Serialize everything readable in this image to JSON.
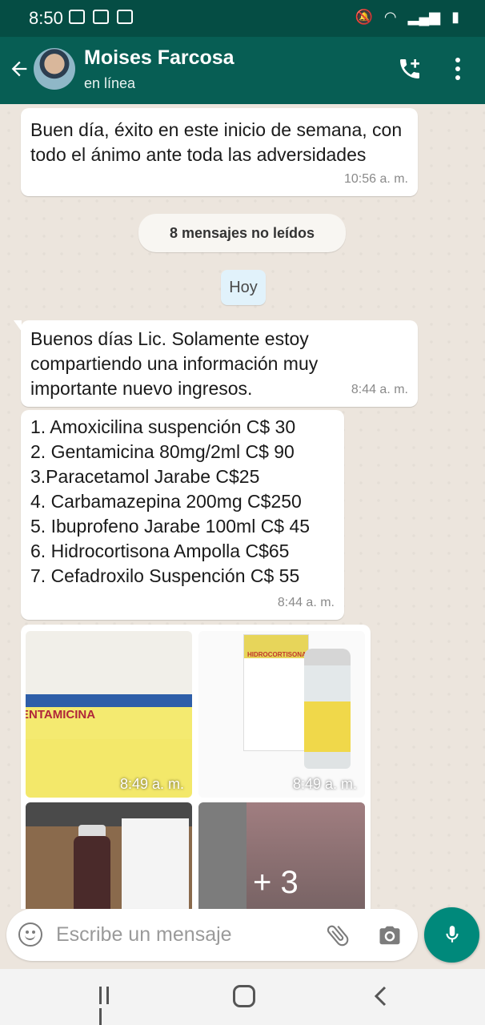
{
  "status_bar": {
    "time": "8:50",
    "left_icons": [
      "gallery-icon",
      "voicemail-icon",
      "instagram-icon"
    ],
    "right_icons": [
      "mute-icon",
      "wifi-icon",
      "signal-icon",
      "battery-icon"
    ]
  },
  "header": {
    "contact_name": "Moises Farcosa",
    "contact_status": "en línea",
    "icons": [
      "back-arrow-icon",
      "add-call-icon",
      "more-vert-icon"
    ]
  },
  "chat": {
    "messages": [
      {
        "text": "Buen día, éxito en este inicio de semana, con todo el ánimo ante toda las adversidades",
        "time": "10:56 a. m."
      },
      {
        "text": "Buenos días Lic. Solamente estoy compartiendo una información muy importante nuevo ingresos.",
        "time": "8:44 a. m."
      }
    ],
    "unread_banner": "8 mensajes no leídos",
    "date_chip": "Hoy",
    "price_list": {
      "items": [
        "1. Amoxicilina suspención C$ 30",
        "2. Gentamicina 80mg/2ml C$ 90",
        "3.Paracetamol Jarabe C$25",
        "4. Carbamazepina 200mg C$250",
        "5. Ibuprofeno Jarabe 100ml C$ 45",
        "6. Hidrocortisona Ampolla C$65",
        "7. Cefadroxilo Suspención C$ 55"
      ],
      "time": "8:44 a. m."
    },
    "media": {
      "images": [
        {
          "label": "ENTAMICINA",
          "time": "8:49 a. m."
        },
        {
          "label": "HIDROCORTISONA",
          "time": "8:49 a. m."
        },
        {
          "label": ""
        },
        {
          "label": ""
        }
      ],
      "more_count": "+ 3"
    }
  },
  "input": {
    "placeholder": "Escribe un mensaje",
    "icons": [
      "emoji-icon",
      "attach-icon",
      "camera-icon",
      "mic-icon"
    ]
  },
  "navbar": {
    "buttons": [
      "recents",
      "home",
      "back"
    ]
  },
  "colors": {
    "header": "#075e54",
    "status_bar": "#054d44",
    "chat_bg": "#ece5dd",
    "accent": "#00897b",
    "date_chip": "#e1f2fb"
  }
}
